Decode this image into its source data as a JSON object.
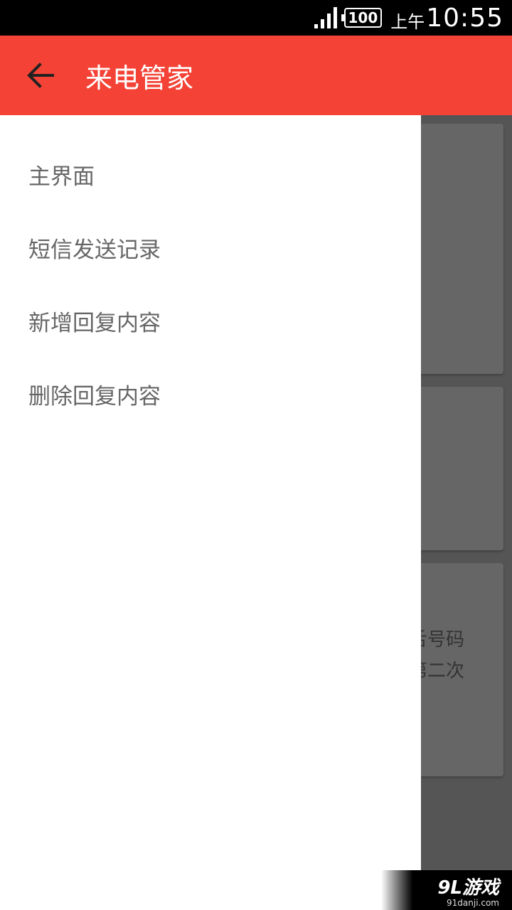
{
  "status_bar": {
    "battery": "100",
    "time_prefix": "上午",
    "time": "10:55"
  },
  "app_bar": {
    "title": "来电管家",
    "back_icon": "arrow-back-icon"
  },
  "drawer": {
    "items": [
      {
        "label": "主界面"
      },
      {
        "label": "短信发送记录"
      },
      {
        "label": "新增回复内容"
      },
      {
        "label": "删除回复内容"
      }
    ]
  },
  "background": {
    "card_text_line1": "舌号码",
    "card_text_line2": "第二次"
  },
  "watermark": {
    "logo": "9L游戏",
    "url": "91danji.com"
  },
  "colors": {
    "accent": "#f44336",
    "drawer_text": "#666666",
    "scrim": "#555555"
  }
}
